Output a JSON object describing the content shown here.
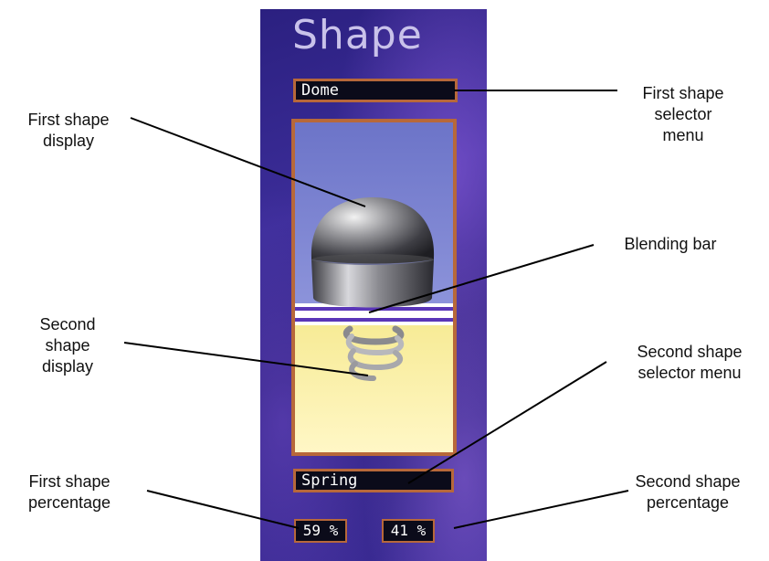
{
  "panel": {
    "title": "Shape",
    "first_selector": {
      "value": "Dome"
    },
    "second_selector": {
      "value": "Spring"
    },
    "first_percentage": "59 %",
    "second_percentage": "41 %"
  },
  "annotations": {
    "first_shape_display": "First shape\ndisplay",
    "first_selector_menu": "First shape\nselector\nmenu",
    "blending_bar": "Blending bar",
    "second_shape_display": "Second\nshape\ndisplay",
    "second_selector_menu": "Second shape\nselector menu",
    "first_percentage": "First shape\npercentage",
    "second_percentage": "Second shape\npercentage"
  },
  "colors": {
    "panel_bg": "#2f2488",
    "frame_border": "#b7683a",
    "first_display_bg": "#7c84d0",
    "second_display_bg": "#fbf1ad",
    "blend_line": "#5a36b8"
  },
  "icons": {
    "first_shape": "dome-shape-icon",
    "second_shape": "spring-shape-icon"
  }
}
